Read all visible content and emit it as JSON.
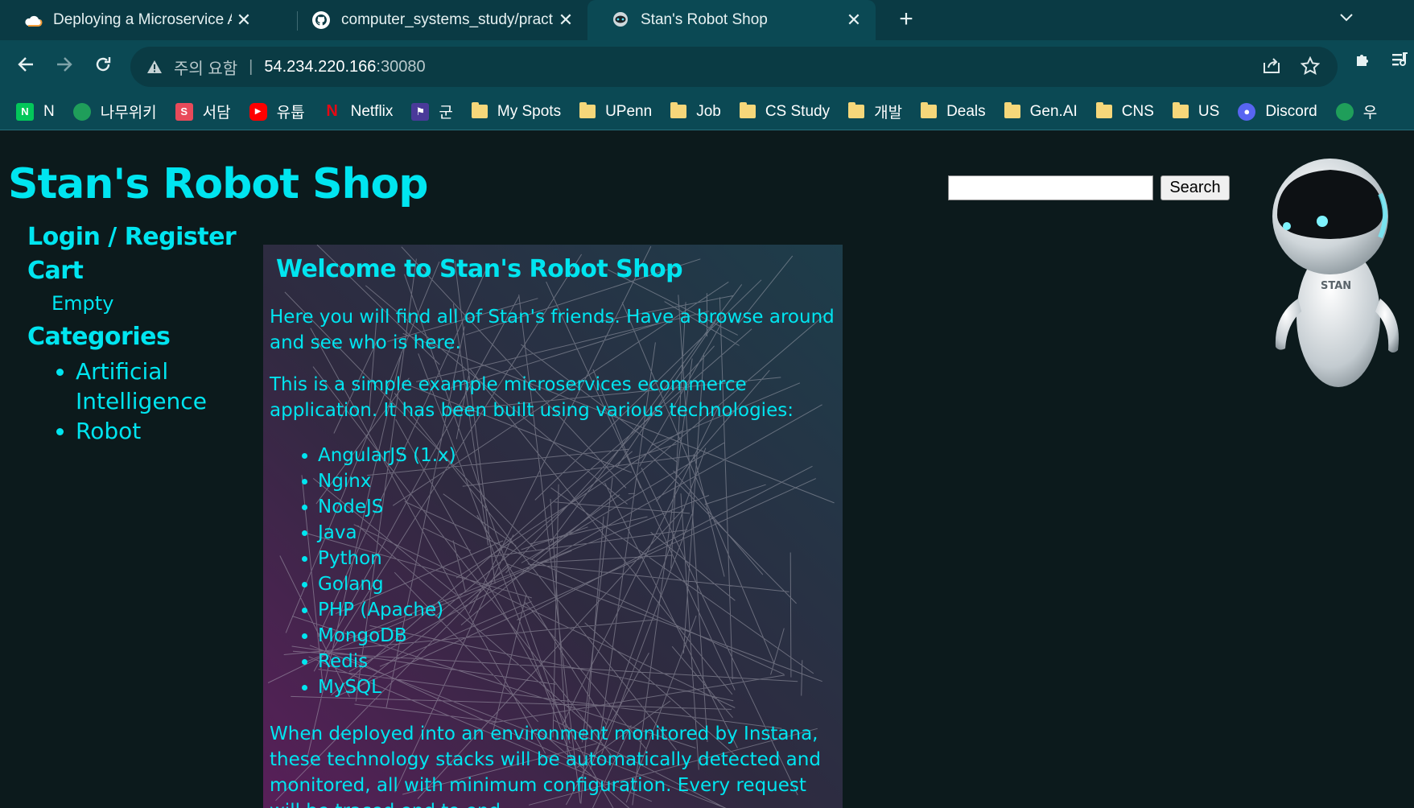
{
  "browser": {
    "tabs": [
      {
        "title": "Deploying a Microservice Appli",
        "favicon": "cloud-icon"
      },
      {
        "title": "computer_systems_study/practi",
        "favicon": "github-icon"
      },
      {
        "title": "Stan's Robot Shop",
        "favicon": "robot-icon",
        "active": true
      }
    ],
    "close_glyph": "✕",
    "new_tab_glyph": "+",
    "address": {
      "warning_text": "주의 요함",
      "separator": "|",
      "host": "54.234.220.166",
      "port": ":30080"
    },
    "bookmarks": [
      {
        "label": "N",
        "icon": "naver-icon",
        "color": "#03c75a"
      },
      {
        "label": "나무위키",
        "icon": "namuwiki-icon",
        "color": "#1f9e5a"
      },
      {
        "label": "서담",
        "icon": "seodam-icon",
        "color": "#e84a5a"
      },
      {
        "label": "유툽",
        "icon": "youtube-icon",
        "color": "#ff0000"
      },
      {
        "label": "Netflix",
        "icon": "netflix-icon",
        "color": "#e50914"
      },
      {
        "label": "군",
        "icon": "military-icon",
        "color": "#4a3a9a"
      },
      {
        "label": "My Spots",
        "icon": "folder-icon"
      },
      {
        "label": "UPenn",
        "icon": "folder-icon"
      },
      {
        "label": "Job",
        "icon": "folder-icon"
      },
      {
        "label": "CS Study",
        "icon": "folder-icon"
      },
      {
        "label": "개발",
        "icon": "folder-icon"
      },
      {
        "label": "Deals",
        "icon": "folder-icon"
      },
      {
        "label": "Gen.AI",
        "icon": "folder-icon"
      },
      {
        "label": "CNS",
        "icon": "folder-icon"
      },
      {
        "label": "US",
        "icon": "folder-icon"
      },
      {
        "label": "Discord",
        "icon": "discord-icon",
        "color": "#5865f2"
      },
      {
        "label": "우",
        "icon": "namuwiki-icon",
        "color": "#1f9e5a"
      }
    ]
  },
  "site": {
    "title": "Stan's Robot Shop",
    "search_button": "Search",
    "search_value": "",
    "robot_label": "STAN",
    "sidebar": {
      "login": "Login / Register",
      "cart": "Cart",
      "cart_status": "Empty",
      "categories_heading": "Categories",
      "categories": [
        "Artificial Intelligence",
        "Robot"
      ]
    },
    "main": {
      "welcome": "Welcome to Stan's Robot Shop",
      "intro": "Here you will find all of Stan's friends. Have a browse around and see who is here.",
      "tech_intro": "This is a simple example microservices ecommerce application. It has been built using various technologies:",
      "technologies": [
        "AngularJS (1.x)",
        "Nginx",
        "NodeJS",
        "Java",
        "Python",
        "Golang",
        "PHP (Apache)",
        "MongoDB",
        "Redis",
        "MySQL"
      ],
      "instana_text": "When deployed into an environment monitored by Instana, these technology stacks will be automatically detected and monitored, all with minimum configuration. Every request will be traced end to end."
    }
  },
  "colors": {
    "accent": "#00e5f0",
    "page_bg": "#0c1a1c",
    "chrome_bg": "#0b4954"
  }
}
